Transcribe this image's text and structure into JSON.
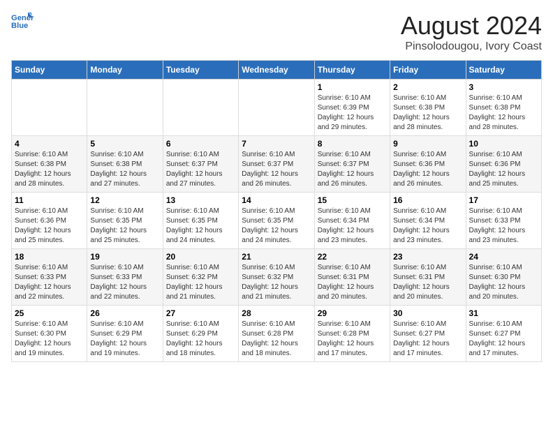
{
  "header": {
    "logo_line1": "General",
    "logo_line2": "Blue",
    "main_title": "August 2024",
    "subtitle": "Pinsolodougou, Ivory Coast"
  },
  "days_of_week": [
    "Sunday",
    "Monday",
    "Tuesday",
    "Wednesday",
    "Thursday",
    "Friday",
    "Saturday"
  ],
  "weeks": [
    [
      {
        "day": "",
        "info": ""
      },
      {
        "day": "",
        "info": ""
      },
      {
        "day": "",
        "info": ""
      },
      {
        "day": "",
        "info": ""
      },
      {
        "day": "1",
        "info": "Sunrise: 6:10 AM\nSunset: 6:39 PM\nDaylight: 12 hours and 29 minutes."
      },
      {
        "day": "2",
        "info": "Sunrise: 6:10 AM\nSunset: 6:38 PM\nDaylight: 12 hours and 28 minutes."
      },
      {
        "day": "3",
        "info": "Sunrise: 6:10 AM\nSunset: 6:38 PM\nDaylight: 12 hours and 28 minutes."
      }
    ],
    [
      {
        "day": "4",
        "info": "Sunrise: 6:10 AM\nSunset: 6:38 PM\nDaylight: 12 hours and 28 minutes."
      },
      {
        "day": "5",
        "info": "Sunrise: 6:10 AM\nSunset: 6:38 PM\nDaylight: 12 hours and 27 minutes."
      },
      {
        "day": "6",
        "info": "Sunrise: 6:10 AM\nSunset: 6:37 PM\nDaylight: 12 hours and 27 minutes."
      },
      {
        "day": "7",
        "info": "Sunrise: 6:10 AM\nSunset: 6:37 PM\nDaylight: 12 hours and 26 minutes."
      },
      {
        "day": "8",
        "info": "Sunrise: 6:10 AM\nSunset: 6:37 PM\nDaylight: 12 hours and 26 minutes."
      },
      {
        "day": "9",
        "info": "Sunrise: 6:10 AM\nSunset: 6:36 PM\nDaylight: 12 hours and 26 minutes."
      },
      {
        "day": "10",
        "info": "Sunrise: 6:10 AM\nSunset: 6:36 PM\nDaylight: 12 hours and 25 minutes."
      }
    ],
    [
      {
        "day": "11",
        "info": "Sunrise: 6:10 AM\nSunset: 6:36 PM\nDaylight: 12 hours and 25 minutes."
      },
      {
        "day": "12",
        "info": "Sunrise: 6:10 AM\nSunset: 6:35 PM\nDaylight: 12 hours and 25 minutes."
      },
      {
        "day": "13",
        "info": "Sunrise: 6:10 AM\nSunset: 6:35 PM\nDaylight: 12 hours and 24 minutes."
      },
      {
        "day": "14",
        "info": "Sunrise: 6:10 AM\nSunset: 6:35 PM\nDaylight: 12 hours and 24 minutes."
      },
      {
        "day": "15",
        "info": "Sunrise: 6:10 AM\nSunset: 6:34 PM\nDaylight: 12 hours and 23 minutes."
      },
      {
        "day": "16",
        "info": "Sunrise: 6:10 AM\nSunset: 6:34 PM\nDaylight: 12 hours and 23 minutes."
      },
      {
        "day": "17",
        "info": "Sunrise: 6:10 AM\nSunset: 6:33 PM\nDaylight: 12 hours and 23 minutes."
      }
    ],
    [
      {
        "day": "18",
        "info": "Sunrise: 6:10 AM\nSunset: 6:33 PM\nDaylight: 12 hours and 22 minutes."
      },
      {
        "day": "19",
        "info": "Sunrise: 6:10 AM\nSunset: 6:33 PM\nDaylight: 12 hours and 22 minutes."
      },
      {
        "day": "20",
        "info": "Sunrise: 6:10 AM\nSunset: 6:32 PM\nDaylight: 12 hours and 21 minutes."
      },
      {
        "day": "21",
        "info": "Sunrise: 6:10 AM\nSunset: 6:32 PM\nDaylight: 12 hours and 21 minutes."
      },
      {
        "day": "22",
        "info": "Sunrise: 6:10 AM\nSunset: 6:31 PM\nDaylight: 12 hours and 20 minutes."
      },
      {
        "day": "23",
        "info": "Sunrise: 6:10 AM\nSunset: 6:31 PM\nDaylight: 12 hours and 20 minutes."
      },
      {
        "day": "24",
        "info": "Sunrise: 6:10 AM\nSunset: 6:30 PM\nDaylight: 12 hours and 20 minutes."
      }
    ],
    [
      {
        "day": "25",
        "info": "Sunrise: 6:10 AM\nSunset: 6:30 PM\nDaylight: 12 hours and 19 minutes."
      },
      {
        "day": "26",
        "info": "Sunrise: 6:10 AM\nSunset: 6:29 PM\nDaylight: 12 hours and 19 minutes."
      },
      {
        "day": "27",
        "info": "Sunrise: 6:10 AM\nSunset: 6:29 PM\nDaylight: 12 hours and 18 minutes."
      },
      {
        "day": "28",
        "info": "Sunrise: 6:10 AM\nSunset: 6:28 PM\nDaylight: 12 hours and 18 minutes."
      },
      {
        "day": "29",
        "info": "Sunrise: 6:10 AM\nSunset: 6:28 PM\nDaylight: 12 hours and 17 minutes."
      },
      {
        "day": "30",
        "info": "Sunrise: 6:10 AM\nSunset: 6:27 PM\nDaylight: 12 hours and 17 minutes."
      },
      {
        "day": "31",
        "info": "Sunrise: 6:10 AM\nSunset: 6:27 PM\nDaylight: 12 hours and 17 minutes."
      }
    ]
  ]
}
